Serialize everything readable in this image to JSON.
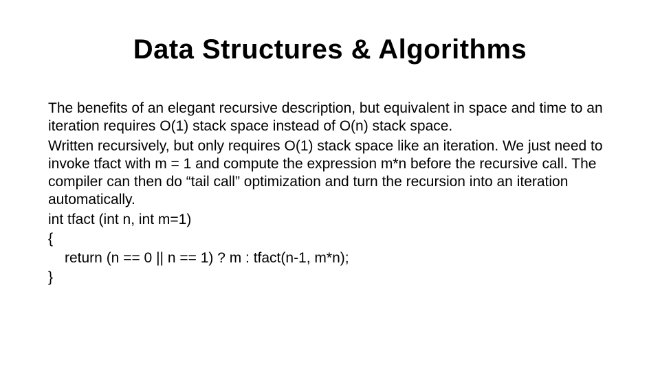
{
  "title": "Data Structures & Algorithms",
  "paragraph1": "The benefits of an elegant recursive description, but equivalent in space and time to an iteration requires O(1) stack space instead of O(n) stack space.",
  "paragraph2": "Written recursively, but only requires O(1) stack space like an iteration. We just need to invoke tfact with m = 1 and compute the expression m*n before the recursive call. The compiler can then do “tail call” optimization and turn the recursion into an iteration automatically.",
  "code": {
    "line1": "int tfact (int n, int m=1)",
    "line2": "{",
    "line3": "return (n == 0 || n == 1) ? m : tfact(n-1, m*n);",
    "line4": "}"
  }
}
